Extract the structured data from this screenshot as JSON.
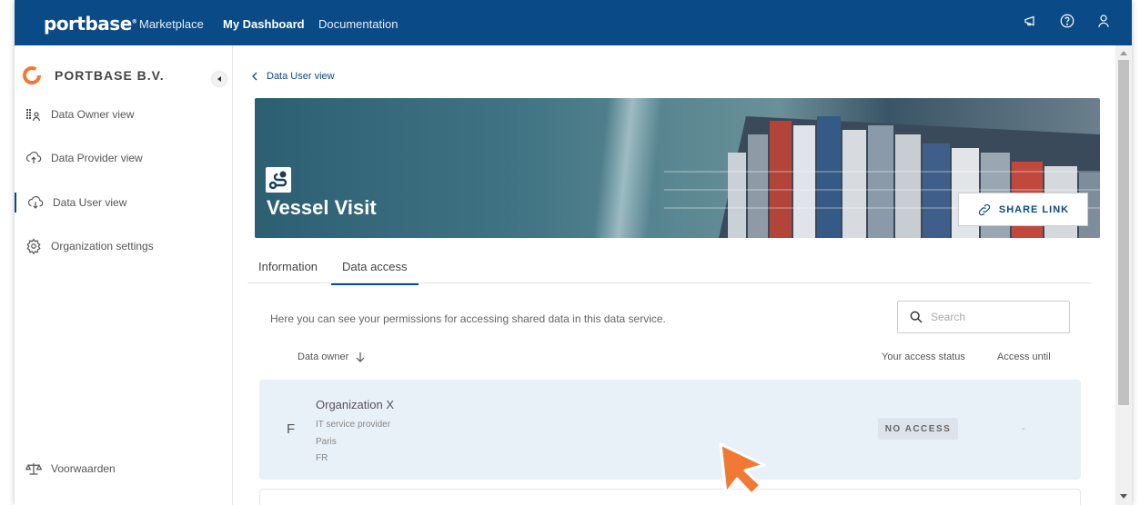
{
  "nav": {
    "logo": "portbase",
    "links": [
      "Marketplace",
      "My Dashboard",
      "Documentation"
    ],
    "active": "My Dashboard"
  },
  "sidebar": {
    "org_name": "PORTBASE B.V.",
    "items": [
      {
        "label": "Data Owner view",
        "icon": "data-owner-icon"
      },
      {
        "label": "Data Provider view",
        "icon": "cloud-upload-icon"
      },
      {
        "label": "Data User view",
        "icon": "cloud-download-icon"
      },
      {
        "label": "Organization settings",
        "icon": "gear-icon"
      }
    ],
    "footer": "Voorwaarden"
  },
  "breadcrumb": "Data User view",
  "hero": {
    "title": "Vessel Visit",
    "share_label": "SHARE LINK"
  },
  "tabs": [
    "Information",
    "Data access"
  ],
  "active_tab": "Data access",
  "description": "Here you can see your permissions for accessing shared data in this data service.",
  "search": {
    "placeholder": "Search"
  },
  "table": {
    "headers": {
      "owner": "Data owner",
      "status": "Your access status",
      "until": "Access until"
    },
    "rows": [
      {
        "avatar": "F",
        "name": "Organization X",
        "type": "IT service provider",
        "city": "Paris",
        "country": "FR",
        "status": "NO ACCESS",
        "until": "-"
      }
    ]
  },
  "colors": {
    "primary": "#0a4a87",
    "row_bg": "#e8f0f8",
    "cursor": "#f07a35"
  }
}
